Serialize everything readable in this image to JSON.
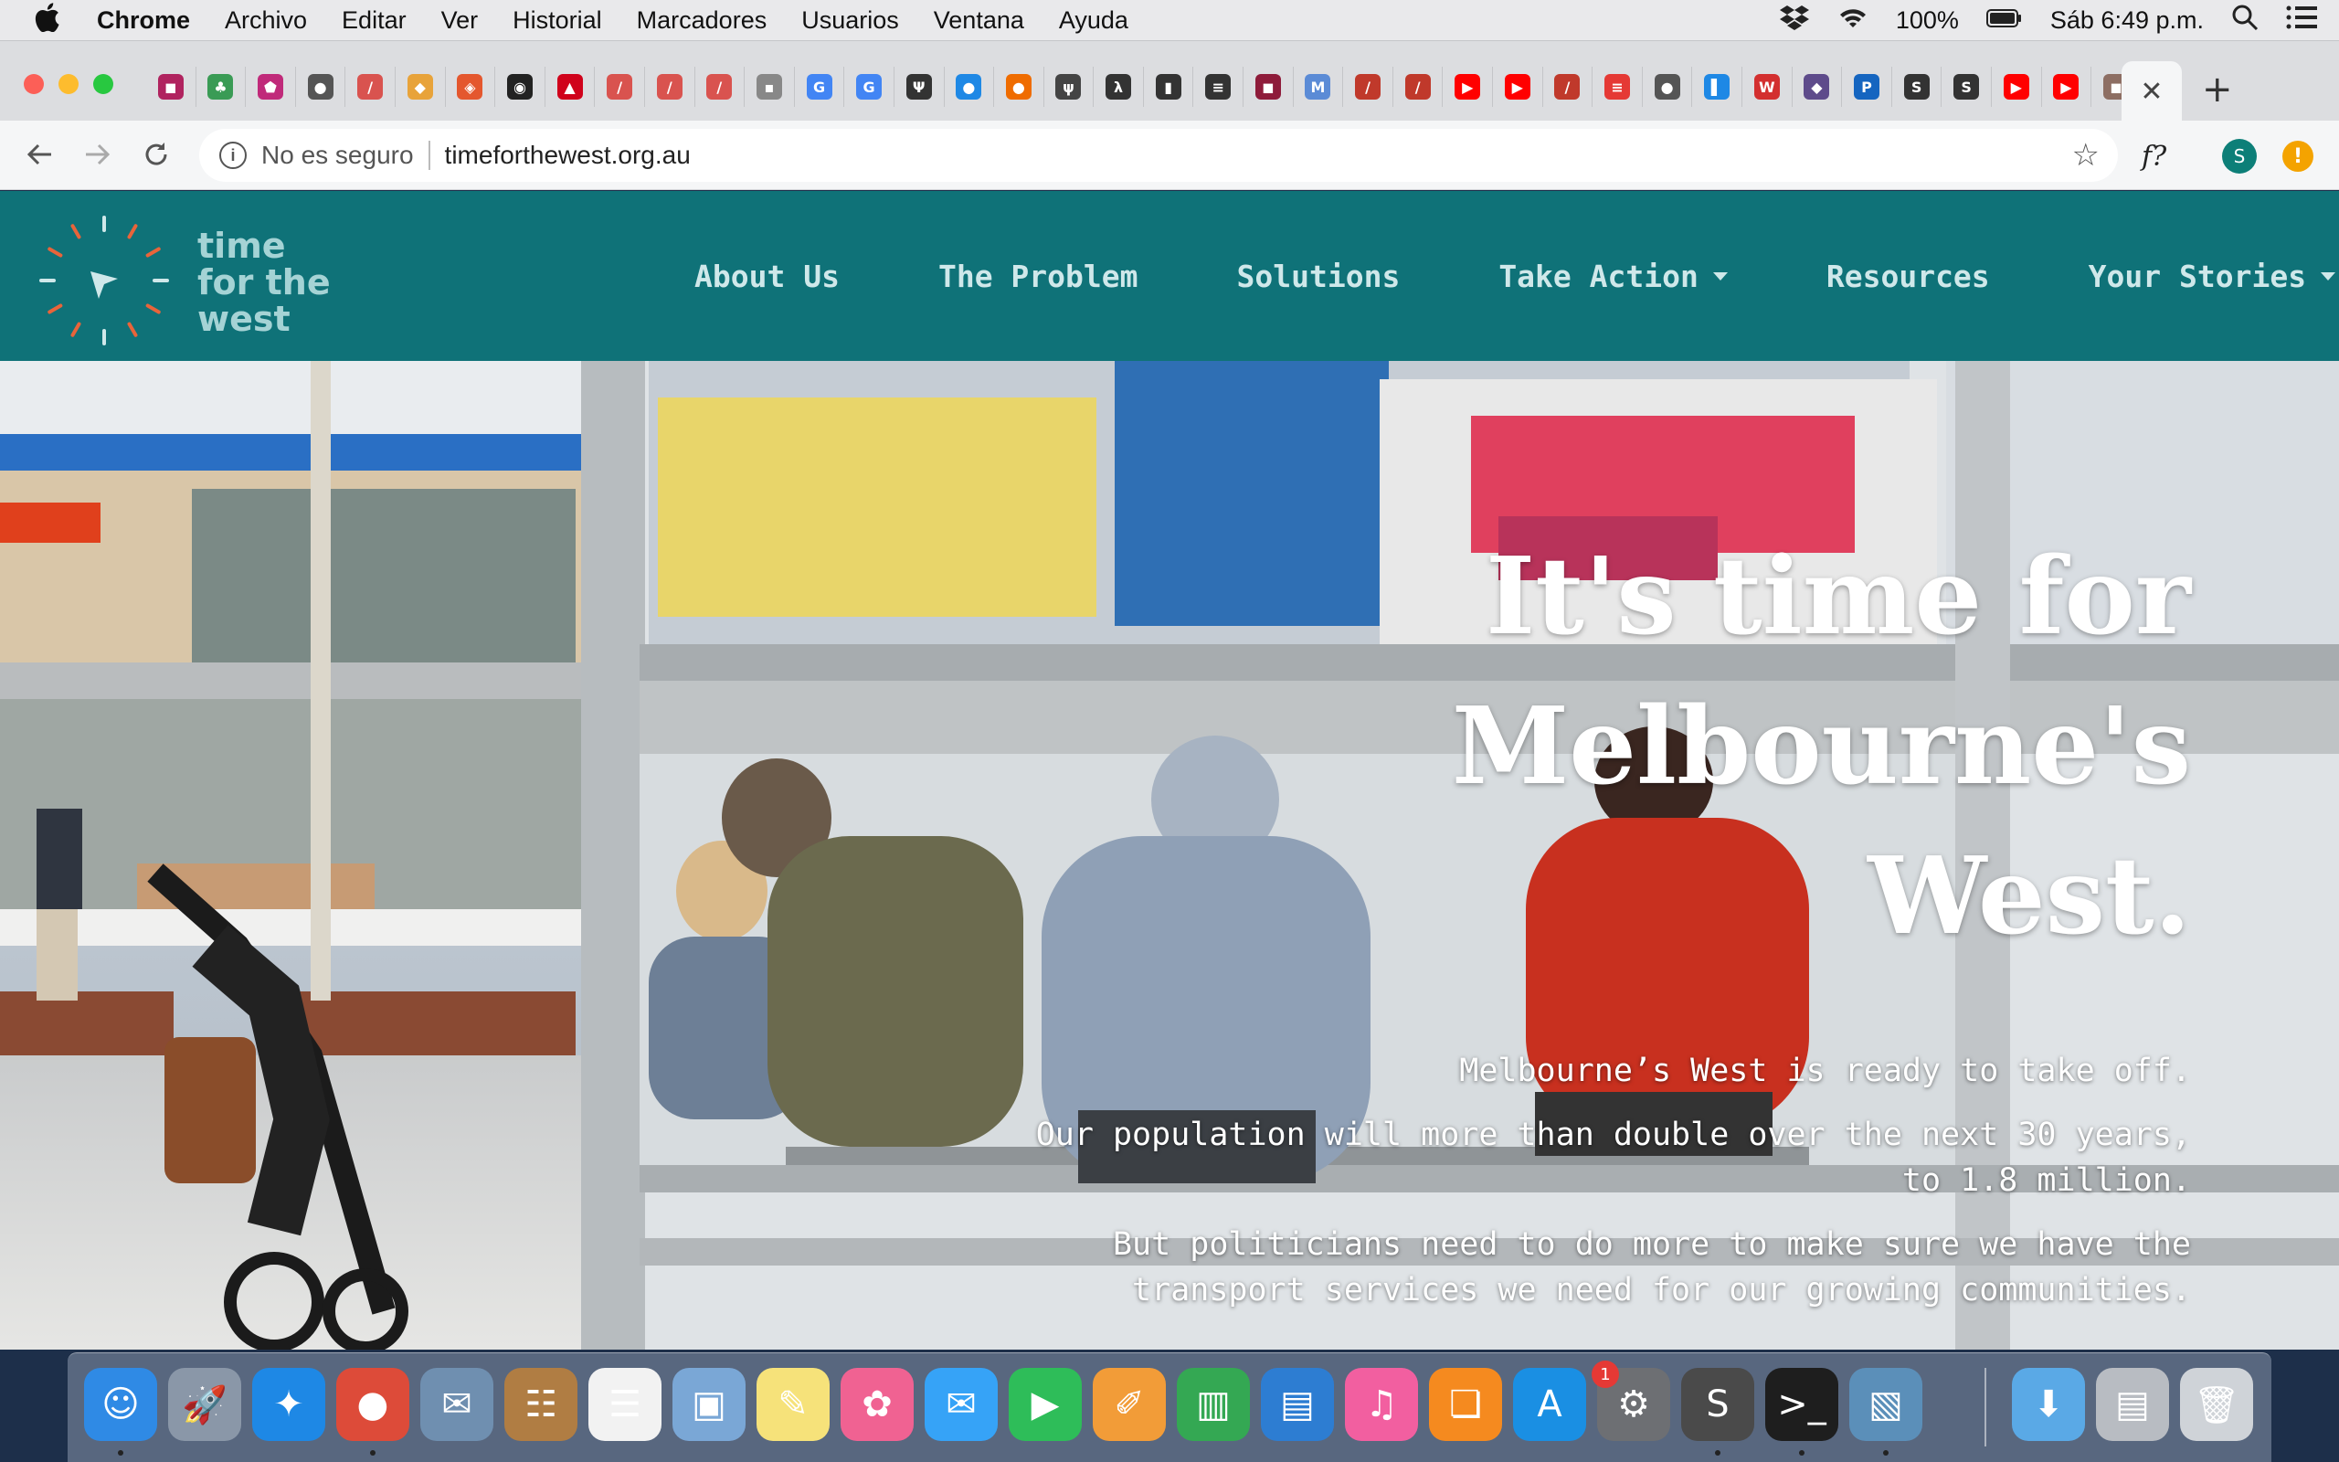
{
  "menubar": {
    "app": "Chrome",
    "items": [
      "Archivo",
      "Editar",
      "Ver",
      "Historial",
      "Marcadores",
      "Usuarios",
      "Ventana",
      "Ayuda"
    ],
    "battery": "100%",
    "clock": "Sáb 6:49 p.m."
  },
  "browser": {
    "security": "No es seguro",
    "url": "timeforthewest.org.au",
    "extension_label": "f?",
    "profile_initial": "S",
    "alert_glyph": "!",
    "close_tab_glyph": "✕",
    "new_tab_glyph": "+",
    "tab_favicons": [
      {
        "glyph": "◼",
        "color": "#b0235f"
      },
      {
        "glyph": "♣",
        "color": "#3a9b55"
      },
      {
        "glyph": "⬟",
        "color": "#c02a7a"
      },
      {
        "glyph": "●",
        "color": "#555555"
      },
      {
        "glyph": "/",
        "color": "#d9534f"
      },
      {
        "glyph": "◆",
        "color": "#e8a33a"
      },
      {
        "glyph": "◈",
        "color": "#e4572e"
      },
      {
        "glyph": "◉",
        "color": "#222222"
      },
      {
        "glyph": "▲",
        "color": "#d0021b"
      },
      {
        "glyph": "/",
        "color": "#d9534f"
      },
      {
        "glyph": "/",
        "color": "#d9534f"
      },
      {
        "glyph": "/",
        "color": "#d9534f"
      },
      {
        "glyph": "▪",
        "color": "#888888"
      },
      {
        "glyph": "G",
        "color": "#4285f4"
      },
      {
        "glyph": "G",
        "color": "#4285f4"
      },
      {
        "glyph": "Ψ",
        "color": "#333333"
      },
      {
        "glyph": "●",
        "color": "#1e88e5"
      },
      {
        "glyph": "●",
        "color": "#ef6c00"
      },
      {
        "glyph": "ψ",
        "color": "#444444"
      },
      {
        "glyph": "λ",
        "color": "#333333"
      },
      {
        "glyph": "▮",
        "color": "#333333"
      },
      {
        "glyph": "≡",
        "color": "#333333"
      },
      {
        "glyph": "◼",
        "color": "#8e1b3a"
      },
      {
        "glyph": "M",
        "color": "#5b8bd6"
      },
      {
        "glyph": "/",
        "color": "#c0392b"
      },
      {
        "glyph": "/",
        "color": "#c0392b"
      },
      {
        "glyph": "▶",
        "color": "#ff0000"
      },
      {
        "glyph": "▶",
        "color": "#ff0000"
      },
      {
        "glyph": "/",
        "color": "#c0392b"
      },
      {
        "glyph": "≡",
        "color": "#e53935"
      },
      {
        "glyph": "●",
        "color": "#555555"
      },
      {
        "glyph": "▌",
        "color": "#1e88e5"
      },
      {
        "glyph": "W",
        "color": "#d32f2f"
      },
      {
        "glyph": "◆",
        "color": "#5e4b8b"
      },
      {
        "glyph": "P",
        "color": "#1565c0"
      },
      {
        "glyph": "S",
        "color": "#333333"
      },
      {
        "glyph": "S",
        "color": "#333333"
      },
      {
        "glyph": "▶",
        "color": "#ff0000"
      },
      {
        "glyph": "▶",
        "color": "#ff0000"
      },
      {
        "glyph": "◼",
        "color": "#8d6e63"
      }
    ]
  },
  "site": {
    "logo_lines": [
      "time",
      "for the",
      "west"
    ],
    "nav": [
      {
        "label": "About Us",
        "dropdown": false
      },
      {
        "label": "The Problem",
        "dropdown": false
      },
      {
        "label": "Solutions",
        "dropdown": false
      },
      {
        "label": "Take Action",
        "dropdown": true
      },
      {
        "label": "Resources",
        "dropdown": false
      },
      {
        "label": "Your Stories",
        "dropdown": true
      }
    ],
    "hero": {
      "title_lines": [
        "It's time for",
        "Melbourne's",
        "West."
      ],
      "p1": "Melbourne’s West is ready to take off.",
      "p2": "Our population will more than double over the next 30 years, to 1.8 million.",
      "p3": "But politicians need to do more to make sure we have the transport services we need for our growing communities."
    },
    "colors": {
      "header": "#0f7278",
      "nav_text": "#cfe8ea",
      "logo_text": "#a5d3d5",
      "logo_accent": "#e8643a"
    }
  },
  "dock": {
    "apps": [
      {
        "name": "finder-icon",
        "glyph": "☺",
        "color": "#2f8ae5",
        "running": true
      },
      {
        "name": "launchpad-icon",
        "glyph": "🚀",
        "color": "#8a97a8",
        "running": false
      },
      {
        "name": "safari-icon",
        "glyph": "✦",
        "color": "#1e88e5",
        "running": false
      },
      {
        "name": "chrome-icon",
        "glyph": "●",
        "color": "#dd4b39",
        "running": true
      },
      {
        "name": "mail-icon",
        "glyph": "✉",
        "color": "#6f8fb0",
        "running": false
      },
      {
        "name": "contacts-icon",
        "glyph": "☷",
        "color": "#b07d43",
        "running": false
      },
      {
        "name": "reminders-icon",
        "glyph": "☰",
        "color": "#f2f2f2",
        "running": false
      },
      {
        "name": "preview-icon",
        "glyph": "▣",
        "color": "#7aa7d6",
        "running": false
      },
      {
        "name": "notes-icon",
        "glyph": "✎",
        "color": "#f6e27a",
        "running": false
      },
      {
        "name": "photos-icon",
        "glyph": "✿",
        "color": "#f06292",
        "running": false
      },
      {
        "name": "messages-icon",
        "glyph": "✉",
        "color": "#36a3f7",
        "running": false
      },
      {
        "name": "facetime-icon",
        "glyph": "▶",
        "color": "#2ebd59",
        "running": false
      },
      {
        "name": "pages-icon",
        "glyph": "✐",
        "color": "#f29c38",
        "running": false
      },
      {
        "name": "numbers-icon",
        "glyph": "▥",
        "color": "#34a853",
        "running": false
      },
      {
        "name": "keynote-icon",
        "glyph": "▤",
        "color": "#2d7dd2",
        "running": false
      },
      {
        "name": "itunes-icon",
        "glyph": "♫",
        "color": "#f25fa0",
        "running": false
      },
      {
        "name": "ibooks-icon",
        "glyph": "❏",
        "color": "#f58a1f",
        "running": false
      },
      {
        "name": "appstore-icon",
        "glyph": "A",
        "color": "#1a8fe3",
        "running": false
      },
      {
        "name": "system-preferences-icon",
        "glyph": "⚙",
        "color": "#6d6f73",
        "running": false
      },
      {
        "name": "sublime-icon",
        "glyph": "S",
        "color": "#4a4a4a",
        "running": true
      },
      {
        "name": "terminal-icon",
        "glyph": ">_",
        "color": "#1e1e1e",
        "running": true
      },
      {
        "name": "preview-photos-icon",
        "glyph": "▧",
        "color": "#5b8fb9",
        "running": true
      }
    ],
    "app_store_badge": "1",
    "right": [
      {
        "name": "downloads-icon",
        "glyph": "⬇",
        "color": "#5aa9e6"
      },
      {
        "name": "document-stack-icon",
        "glyph": "▤",
        "color": "#b8bcc2"
      },
      {
        "name": "trash-icon",
        "glyph": "🗑",
        "color": "#cfd3d8"
      }
    ]
  }
}
